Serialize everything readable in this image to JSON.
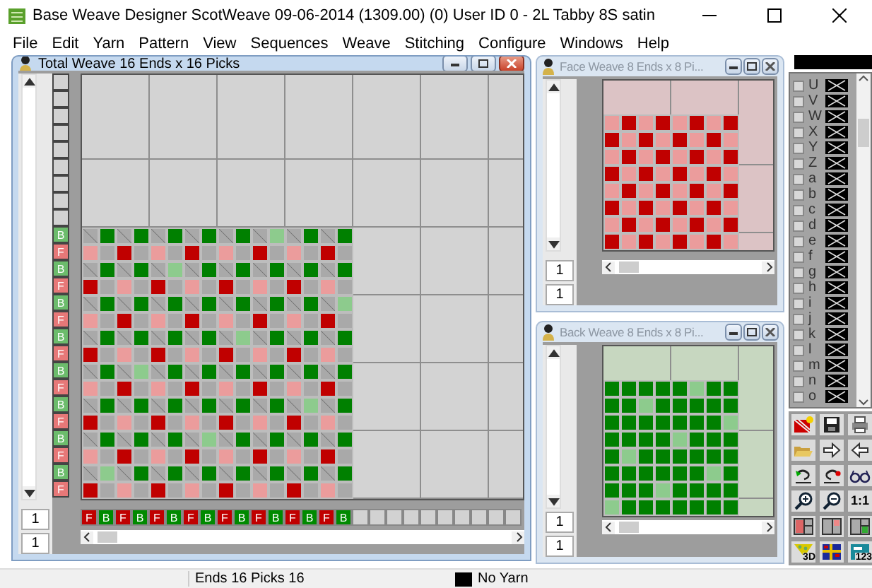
{
  "window": {
    "title": "Base Weave Designer  ScotWeave    09-06-2014 (1309.00) (0)  User ID 0 - 2L Tabby 8S satin"
  },
  "menu": [
    "File",
    "Edit",
    "Yarn",
    "Pattern",
    "View",
    "Sequences",
    "Weave",
    "Stitching",
    "Configure",
    "Windows",
    "Help"
  ],
  "total_weave": {
    "title": "Total Weave  16 Ends x 16 Picks",
    "active": true,
    "pick_labels": [
      {
        "label": "B",
        "kind": "back"
      },
      {
        "label": "F",
        "kind": "face"
      },
      {
        "label": "B",
        "kind": "back"
      },
      {
        "label": "F",
        "kind": "face"
      },
      {
        "label": "B",
        "kind": "back"
      },
      {
        "label": "F",
        "kind": "face"
      },
      {
        "label": "B",
        "kind": "back"
      },
      {
        "label": "F",
        "kind": "face"
      },
      {
        "label": "B",
        "kind": "back"
      },
      {
        "label": "F",
        "kind": "face"
      },
      {
        "label": "B",
        "kind": "back"
      },
      {
        "label": "F",
        "kind": "face"
      },
      {
        "label": "B",
        "kind": "back"
      },
      {
        "label": "F",
        "kind": "face"
      },
      {
        "label": "B",
        "kind": "back"
      },
      {
        "label": "F",
        "kind": "face"
      }
    ],
    "rows": [
      {
        "cells": [
          {
            "kind": "hatch"
          },
          {
            "kind": "green"
          },
          {
            "kind": "hatch"
          },
          {
            "kind": "green"
          },
          {
            "kind": "hatch"
          },
          {
            "kind": "green"
          },
          {
            "kind": "hatch"
          },
          {
            "kind": "green"
          },
          {
            "kind": "hatch"
          },
          {
            "kind": "green"
          },
          {
            "kind": "hatch"
          },
          {
            "kind": "pale"
          },
          {
            "kind": "hatch"
          },
          {
            "kind": "green"
          },
          {
            "kind": "hatch"
          },
          {
            "kind": "green"
          }
        ]
      },
      {
        "cells": [
          {
            "kind": "pink"
          },
          {
            "kind": "grey"
          },
          {
            "kind": "red"
          },
          {
            "kind": "grey"
          },
          {
            "kind": "pink"
          },
          {
            "kind": "grey"
          },
          {
            "kind": "red"
          },
          {
            "kind": "grey"
          },
          {
            "kind": "pink"
          },
          {
            "kind": "grey"
          },
          {
            "kind": "red"
          },
          {
            "kind": "grey"
          },
          {
            "kind": "pink"
          },
          {
            "kind": "grey"
          },
          {
            "kind": "red"
          },
          {
            "kind": "grey"
          }
        ]
      },
      {
        "cells": [
          {
            "kind": "hatch"
          },
          {
            "kind": "green"
          },
          {
            "kind": "hatch"
          },
          {
            "kind": "green"
          },
          {
            "kind": "hatch"
          },
          {
            "kind": "pale"
          },
          {
            "kind": "hatch"
          },
          {
            "kind": "green"
          },
          {
            "kind": "hatch"
          },
          {
            "kind": "green"
          },
          {
            "kind": "hatch"
          },
          {
            "kind": "green"
          },
          {
            "kind": "hatch"
          },
          {
            "kind": "green"
          },
          {
            "kind": "hatch"
          },
          {
            "kind": "green"
          }
        ]
      },
      {
        "cells": [
          {
            "kind": "red"
          },
          {
            "kind": "grey"
          },
          {
            "kind": "pink"
          },
          {
            "kind": "grey"
          },
          {
            "kind": "red"
          },
          {
            "kind": "grey"
          },
          {
            "kind": "pink"
          },
          {
            "kind": "grey"
          },
          {
            "kind": "red"
          },
          {
            "kind": "grey"
          },
          {
            "kind": "pink"
          },
          {
            "kind": "grey"
          },
          {
            "kind": "red"
          },
          {
            "kind": "grey"
          },
          {
            "kind": "pink"
          },
          {
            "kind": "grey"
          }
        ]
      },
      {
        "cells": [
          {
            "kind": "hatch"
          },
          {
            "kind": "green"
          },
          {
            "kind": "hatch"
          },
          {
            "kind": "green"
          },
          {
            "kind": "hatch"
          },
          {
            "kind": "green"
          },
          {
            "kind": "hatch"
          },
          {
            "kind": "green"
          },
          {
            "kind": "hatch"
          },
          {
            "kind": "green"
          },
          {
            "kind": "hatch"
          },
          {
            "kind": "green"
          },
          {
            "kind": "hatch"
          },
          {
            "kind": "green"
          },
          {
            "kind": "hatch"
          },
          {
            "kind": "pale"
          }
        ]
      },
      {
        "cells": [
          {
            "kind": "pink"
          },
          {
            "kind": "grey"
          },
          {
            "kind": "red"
          },
          {
            "kind": "grey"
          },
          {
            "kind": "pink"
          },
          {
            "kind": "grey"
          },
          {
            "kind": "red"
          },
          {
            "kind": "grey"
          },
          {
            "kind": "pink"
          },
          {
            "kind": "grey"
          },
          {
            "kind": "red"
          },
          {
            "kind": "grey"
          },
          {
            "kind": "pink"
          },
          {
            "kind": "grey"
          },
          {
            "kind": "red"
          },
          {
            "kind": "grey"
          }
        ]
      },
      {
        "cells": [
          {
            "kind": "hatch"
          },
          {
            "kind": "green"
          },
          {
            "kind": "hatch"
          },
          {
            "kind": "green"
          },
          {
            "kind": "hatch"
          },
          {
            "kind": "green"
          },
          {
            "kind": "hatch"
          },
          {
            "kind": "green"
          },
          {
            "kind": "hatch"
          },
          {
            "kind": "pale"
          },
          {
            "kind": "hatch"
          },
          {
            "kind": "green"
          },
          {
            "kind": "hatch"
          },
          {
            "kind": "green"
          },
          {
            "kind": "hatch"
          },
          {
            "kind": "green"
          }
        ]
      },
      {
        "cells": [
          {
            "kind": "red"
          },
          {
            "kind": "grey"
          },
          {
            "kind": "pink"
          },
          {
            "kind": "grey"
          },
          {
            "kind": "red"
          },
          {
            "kind": "grey"
          },
          {
            "kind": "pink"
          },
          {
            "kind": "grey"
          },
          {
            "kind": "red"
          },
          {
            "kind": "grey"
          },
          {
            "kind": "pink"
          },
          {
            "kind": "grey"
          },
          {
            "kind": "red"
          },
          {
            "kind": "grey"
          },
          {
            "kind": "pink"
          },
          {
            "kind": "grey"
          }
        ]
      },
      {
        "cells": [
          {
            "kind": "hatch"
          },
          {
            "kind": "green"
          },
          {
            "kind": "hatch"
          },
          {
            "kind": "pale"
          },
          {
            "kind": "hatch"
          },
          {
            "kind": "green"
          },
          {
            "kind": "hatch"
          },
          {
            "kind": "green"
          },
          {
            "kind": "hatch"
          },
          {
            "kind": "green"
          },
          {
            "kind": "hatch"
          },
          {
            "kind": "green"
          },
          {
            "kind": "hatch"
          },
          {
            "kind": "green"
          },
          {
            "kind": "hatch"
          },
          {
            "kind": "green"
          }
        ]
      },
      {
        "cells": [
          {
            "kind": "pink"
          },
          {
            "kind": "grey"
          },
          {
            "kind": "red"
          },
          {
            "kind": "grey"
          },
          {
            "kind": "pink"
          },
          {
            "kind": "grey"
          },
          {
            "kind": "red"
          },
          {
            "kind": "grey"
          },
          {
            "kind": "pink"
          },
          {
            "kind": "grey"
          },
          {
            "kind": "red"
          },
          {
            "kind": "grey"
          },
          {
            "kind": "pink"
          },
          {
            "kind": "grey"
          },
          {
            "kind": "red"
          },
          {
            "kind": "grey"
          }
        ]
      },
      {
        "cells": [
          {
            "kind": "hatch"
          },
          {
            "kind": "green"
          },
          {
            "kind": "hatch"
          },
          {
            "kind": "green"
          },
          {
            "kind": "hatch"
          },
          {
            "kind": "green"
          },
          {
            "kind": "hatch"
          },
          {
            "kind": "green"
          },
          {
            "kind": "hatch"
          },
          {
            "kind": "green"
          },
          {
            "kind": "hatch"
          },
          {
            "kind": "green"
          },
          {
            "kind": "hatch"
          },
          {
            "kind": "pale"
          },
          {
            "kind": "hatch"
          },
          {
            "kind": "green"
          }
        ]
      },
      {
        "cells": [
          {
            "kind": "red"
          },
          {
            "kind": "grey"
          },
          {
            "kind": "pink"
          },
          {
            "kind": "grey"
          },
          {
            "kind": "red"
          },
          {
            "kind": "grey"
          },
          {
            "kind": "pink"
          },
          {
            "kind": "grey"
          },
          {
            "kind": "red"
          },
          {
            "kind": "grey"
          },
          {
            "kind": "pink"
          },
          {
            "kind": "grey"
          },
          {
            "kind": "red"
          },
          {
            "kind": "grey"
          },
          {
            "kind": "pink"
          },
          {
            "kind": "grey"
          }
        ]
      },
      {
        "cells": [
          {
            "kind": "hatch"
          },
          {
            "kind": "green"
          },
          {
            "kind": "hatch"
          },
          {
            "kind": "green"
          },
          {
            "kind": "hatch"
          },
          {
            "kind": "green"
          },
          {
            "kind": "hatch"
          },
          {
            "kind": "pale"
          },
          {
            "kind": "hatch"
          },
          {
            "kind": "green"
          },
          {
            "kind": "hatch"
          },
          {
            "kind": "green"
          },
          {
            "kind": "hatch"
          },
          {
            "kind": "green"
          },
          {
            "kind": "hatch"
          },
          {
            "kind": "green"
          }
        ]
      },
      {
        "cells": [
          {
            "kind": "pink"
          },
          {
            "kind": "grey"
          },
          {
            "kind": "red"
          },
          {
            "kind": "grey"
          },
          {
            "kind": "pink"
          },
          {
            "kind": "grey"
          },
          {
            "kind": "red"
          },
          {
            "kind": "grey"
          },
          {
            "kind": "pink"
          },
          {
            "kind": "grey"
          },
          {
            "kind": "red"
          },
          {
            "kind": "grey"
          },
          {
            "kind": "pink"
          },
          {
            "kind": "grey"
          },
          {
            "kind": "red"
          },
          {
            "kind": "grey"
          }
        ]
      },
      {
        "cells": [
          {
            "kind": "hatch"
          },
          {
            "kind": "pale"
          },
          {
            "kind": "hatch"
          },
          {
            "kind": "green"
          },
          {
            "kind": "hatch"
          },
          {
            "kind": "green"
          },
          {
            "kind": "hatch"
          },
          {
            "kind": "green"
          },
          {
            "kind": "hatch"
          },
          {
            "kind": "green"
          },
          {
            "kind": "hatch"
          },
          {
            "kind": "green"
          },
          {
            "kind": "hatch"
          },
          {
            "kind": "green"
          },
          {
            "kind": "hatch"
          },
          {
            "kind": "green"
          }
        ]
      },
      {
        "cells": [
          {
            "kind": "red"
          },
          {
            "kind": "grey"
          },
          {
            "kind": "pink"
          },
          {
            "kind": "grey"
          },
          {
            "kind": "red"
          },
          {
            "kind": "grey"
          },
          {
            "kind": "pink"
          },
          {
            "kind": "grey"
          },
          {
            "kind": "red"
          },
          {
            "kind": "grey"
          },
          {
            "kind": "pink"
          },
          {
            "kind": "grey"
          },
          {
            "kind": "red"
          },
          {
            "kind": "grey"
          },
          {
            "kind": "pink"
          },
          {
            "kind": "grey"
          }
        ]
      }
    ],
    "end_labels": [
      {
        "label": "F",
        "kind": "face"
      },
      {
        "label": "B",
        "kind": "back"
      },
      {
        "label": "F",
        "kind": "face"
      },
      {
        "label": "B",
        "kind": "back"
      },
      {
        "label": "F",
        "kind": "face"
      },
      {
        "label": "B",
        "kind": "back"
      },
      {
        "label": "F",
        "kind": "face"
      },
      {
        "label": "B",
        "kind": "back"
      },
      {
        "label": "F",
        "kind": "face"
      },
      {
        "label": "B",
        "kind": "back"
      },
      {
        "label": "F",
        "kind": "face"
      },
      {
        "label": "B",
        "kind": "back"
      },
      {
        "label": "F",
        "kind": "face"
      },
      {
        "label": "B",
        "kind": "back"
      },
      {
        "label": "F",
        "kind": "face"
      },
      {
        "label": "B",
        "kind": "back"
      }
    ],
    "fields": [
      "1",
      "1"
    ]
  },
  "face_weave": {
    "title": "Face Weave  8 Ends x 8 Pi...",
    "active": false,
    "rows": [
      {
        "cells": [
          {
            "kind": "pink"
          },
          {
            "kind": "red"
          },
          {
            "kind": "pink"
          },
          {
            "kind": "red"
          },
          {
            "kind": "pink"
          },
          {
            "kind": "red"
          },
          {
            "kind": "pink"
          },
          {
            "kind": "red"
          }
        ]
      },
      {
        "cells": [
          {
            "kind": "red"
          },
          {
            "kind": "pink"
          },
          {
            "kind": "red"
          },
          {
            "kind": "pink"
          },
          {
            "kind": "red"
          },
          {
            "kind": "pink"
          },
          {
            "kind": "red"
          },
          {
            "kind": "pink"
          }
        ]
      },
      {
        "cells": [
          {
            "kind": "pink"
          },
          {
            "kind": "red"
          },
          {
            "kind": "pink"
          },
          {
            "kind": "red"
          },
          {
            "kind": "pink"
          },
          {
            "kind": "red"
          },
          {
            "kind": "pink"
          },
          {
            "kind": "red"
          }
        ]
      },
      {
        "cells": [
          {
            "kind": "red"
          },
          {
            "kind": "pink"
          },
          {
            "kind": "red"
          },
          {
            "kind": "pink"
          },
          {
            "kind": "red"
          },
          {
            "kind": "pink"
          },
          {
            "kind": "red"
          },
          {
            "kind": "pink"
          }
        ]
      },
      {
        "cells": [
          {
            "kind": "pink"
          },
          {
            "kind": "red"
          },
          {
            "kind": "pink"
          },
          {
            "kind": "red"
          },
          {
            "kind": "pink"
          },
          {
            "kind": "red"
          },
          {
            "kind": "pink"
          },
          {
            "kind": "red"
          }
        ]
      },
      {
        "cells": [
          {
            "kind": "red"
          },
          {
            "kind": "pink"
          },
          {
            "kind": "red"
          },
          {
            "kind": "pink"
          },
          {
            "kind": "red"
          },
          {
            "kind": "pink"
          },
          {
            "kind": "red"
          },
          {
            "kind": "pink"
          }
        ]
      },
      {
        "cells": [
          {
            "kind": "pink"
          },
          {
            "kind": "red"
          },
          {
            "kind": "pink"
          },
          {
            "kind": "red"
          },
          {
            "kind": "pink"
          },
          {
            "kind": "red"
          },
          {
            "kind": "pink"
          },
          {
            "kind": "red"
          }
        ]
      },
      {
        "cells": [
          {
            "kind": "red"
          },
          {
            "kind": "pink"
          },
          {
            "kind": "red"
          },
          {
            "kind": "pink"
          },
          {
            "kind": "red"
          },
          {
            "kind": "pink"
          },
          {
            "kind": "red"
          },
          {
            "kind": "pink"
          }
        ]
      }
    ],
    "fields": [
      "1",
      "1"
    ]
  },
  "back_weave": {
    "title": "Back Weave  8 Ends x 8 Pi...",
    "active": false,
    "rows": [
      {
        "cells": [
          {
            "kind": "green"
          },
          {
            "kind": "green"
          },
          {
            "kind": "green"
          },
          {
            "kind": "green"
          },
          {
            "kind": "green"
          },
          {
            "kind": "pale"
          },
          {
            "kind": "green"
          },
          {
            "kind": "green"
          }
        ]
      },
      {
        "cells": [
          {
            "kind": "green"
          },
          {
            "kind": "green"
          },
          {
            "kind": "pale"
          },
          {
            "kind": "green"
          },
          {
            "kind": "green"
          },
          {
            "kind": "green"
          },
          {
            "kind": "green"
          },
          {
            "kind": "green"
          }
        ]
      },
      {
        "cells": [
          {
            "kind": "green"
          },
          {
            "kind": "green"
          },
          {
            "kind": "green"
          },
          {
            "kind": "green"
          },
          {
            "kind": "green"
          },
          {
            "kind": "green"
          },
          {
            "kind": "green"
          },
          {
            "kind": "pale"
          }
        ]
      },
      {
        "cells": [
          {
            "kind": "green"
          },
          {
            "kind": "green"
          },
          {
            "kind": "green"
          },
          {
            "kind": "green"
          },
          {
            "kind": "pale"
          },
          {
            "kind": "green"
          },
          {
            "kind": "green"
          },
          {
            "kind": "green"
          }
        ]
      },
      {
        "cells": [
          {
            "kind": "green"
          },
          {
            "kind": "pale"
          },
          {
            "kind": "green"
          },
          {
            "kind": "green"
          },
          {
            "kind": "green"
          },
          {
            "kind": "green"
          },
          {
            "kind": "green"
          },
          {
            "kind": "green"
          }
        ]
      },
      {
        "cells": [
          {
            "kind": "green"
          },
          {
            "kind": "green"
          },
          {
            "kind": "green"
          },
          {
            "kind": "green"
          },
          {
            "kind": "green"
          },
          {
            "kind": "green"
          },
          {
            "kind": "pale"
          },
          {
            "kind": "green"
          }
        ]
      },
      {
        "cells": [
          {
            "kind": "green"
          },
          {
            "kind": "green"
          },
          {
            "kind": "green"
          },
          {
            "kind": "pale"
          },
          {
            "kind": "green"
          },
          {
            "kind": "green"
          },
          {
            "kind": "green"
          },
          {
            "kind": "green"
          }
        ]
      },
      {
        "cells": [
          {
            "kind": "pale"
          },
          {
            "kind": "green"
          },
          {
            "kind": "green"
          },
          {
            "kind": "green"
          },
          {
            "kind": "green"
          },
          {
            "kind": "green"
          },
          {
            "kind": "green"
          },
          {
            "kind": "green"
          }
        ]
      }
    ],
    "fields": [
      "1",
      "1"
    ]
  },
  "yarn_list": [
    {
      "code": "U",
      "checked": false
    },
    {
      "code": "V",
      "checked": false
    },
    {
      "code": "W",
      "checked": false
    },
    {
      "code": "X",
      "checked": false
    },
    {
      "code": "Y",
      "checked": false
    },
    {
      "code": "Z",
      "checked": false
    },
    {
      "code": "a",
      "checked": false
    },
    {
      "code": "b",
      "checked": false
    },
    {
      "code": "c",
      "checked": false
    },
    {
      "code": "d",
      "checked": false
    },
    {
      "code": "e",
      "checked": false
    },
    {
      "code": "f",
      "checked": false
    },
    {
      "code": "g",
      "checked": false
    },
    {
      "code": "h",
      "checked": false
    },
    {
      "code": "i",
      "checked": false
    },
    {
      "code": "j",
      "checked": false
    },
    {
      "code": "k",
      "checked": false
    },
    {
      "code": "l",
      "checked": false
    },
    {
      "code": "m",
      "checked": false
    },
    {
      "code": "n",
      "checked": false
    },
    {
      "code": "o",
      "checked": false
    }
  ],
  "toolbar": [
    {
      "kind": "new"
    },
    {
      "kind": "save"
    },
    {
      "kind": "print"
    },
    {
      "kind": "open"
    },
    {
      "kind": "forward"
    },
    {
      "kind": "backward"
    },
    {
      "kind": "undo"
    },
    {
      "kind": "redo"
    },
    {
      "kind": "glasses"
    },
    {
      "kind": "zoom_in"
    },
    {
      "kind": "zoom_out"
    },
    {
      "kind": "actual_size",
      "label": "1:1"
    },
    {
      "kind": "layout_left"
    },
    {
      "kind": "layout_right"
    },
    {
      "kind": "layout_split"
    },
    {
      "kind": "view_3d",
      "label": "3D"
    },
    {
      "kind": "colour_grid"
    },
    {
      "kind": "numbers",
      "label": "123"
    }
  ],
  "status_bar": {
    "dimensions": "Ends 16 Picks 16",
    "yarn": "No Yarn"
  }
}
